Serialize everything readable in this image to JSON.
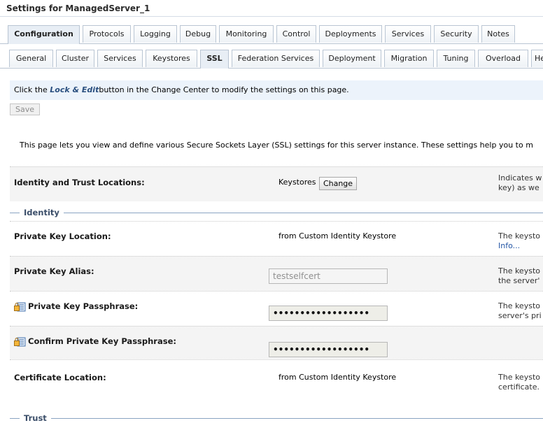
{
  "header": {
    "title": "Settings for ManagedServer_1"
  },
  "primary_tabs": [
    "Configuration",
    "Protocols",
    "Logging",
    "Debug",
    "Monitoring",
    "Control",
    "Deployments",
    "Services",
    "Security",
    "Notes"
  ],
  "primary_active": "Configuration",
  "secondary_tabs": [
    "General",
    "Cluster",
    "Services",
    "Keystores",
    "SSL",
    "Federation Services",
    "Deployment",
    "Migration",
    "Tuning",
    "Overload",
    "He"
  ],
  "secondary_active": "SSL",
  "notice": {
    "prefix": "Click the ",
    "emphasis": "Lock & Edit",
    "suffix": "button in the Change Center to modify the settings on this page."
  },
  "save_label": "Save",
  "intro": "This page lets you view and define various Secure Sockets Layer (SSL) settings for this server instance. These settings help you to m",
  "identity_trust": {
    "label": "Identity and Trust Locations:",
    "value": "Keystores",
    "button": "Change",
    "help1": "Indicates w",
    "help2": "key) as we"
  },
  "sections": {
    "identity": "Identity",
    "trust": "Trust"
  },
  "fields": {
    "pk_location": {
      "label": "Private Key Location:",
      "value": "from Custom Identity Keystore",
      "help1": "The keysto",
      "help_link": "Info..."
    },
    "pk_alias": {
      "label": "Private Key Alias:",
      "value": "testselfcert",
      "help1": "The keysto",
      "help2": "the server'"
    },
    "pk_pass": {
      "label": "Private Key Passphrase:",
      "value": "••••••••••••••••••",
      "help1": "The keysto",
      "help2": "server's pri"
    },
    "pk_confirm": {
      "label": "Confirm Private Key Passphrase:",
      "value": "••••••••••••••••••"
    },
    "cert_location": {
      "label": "Certificate Location:",
      "value": "from Custom Identity Keystore",
      "help1": "The keysto",
      "help2": "certificate."
    }
  },
  "colors": {
    "accent": "#2a4f7f",
    "notice_bg": "#ecf3fb",
    "link": "#2456a5"
  }
}
